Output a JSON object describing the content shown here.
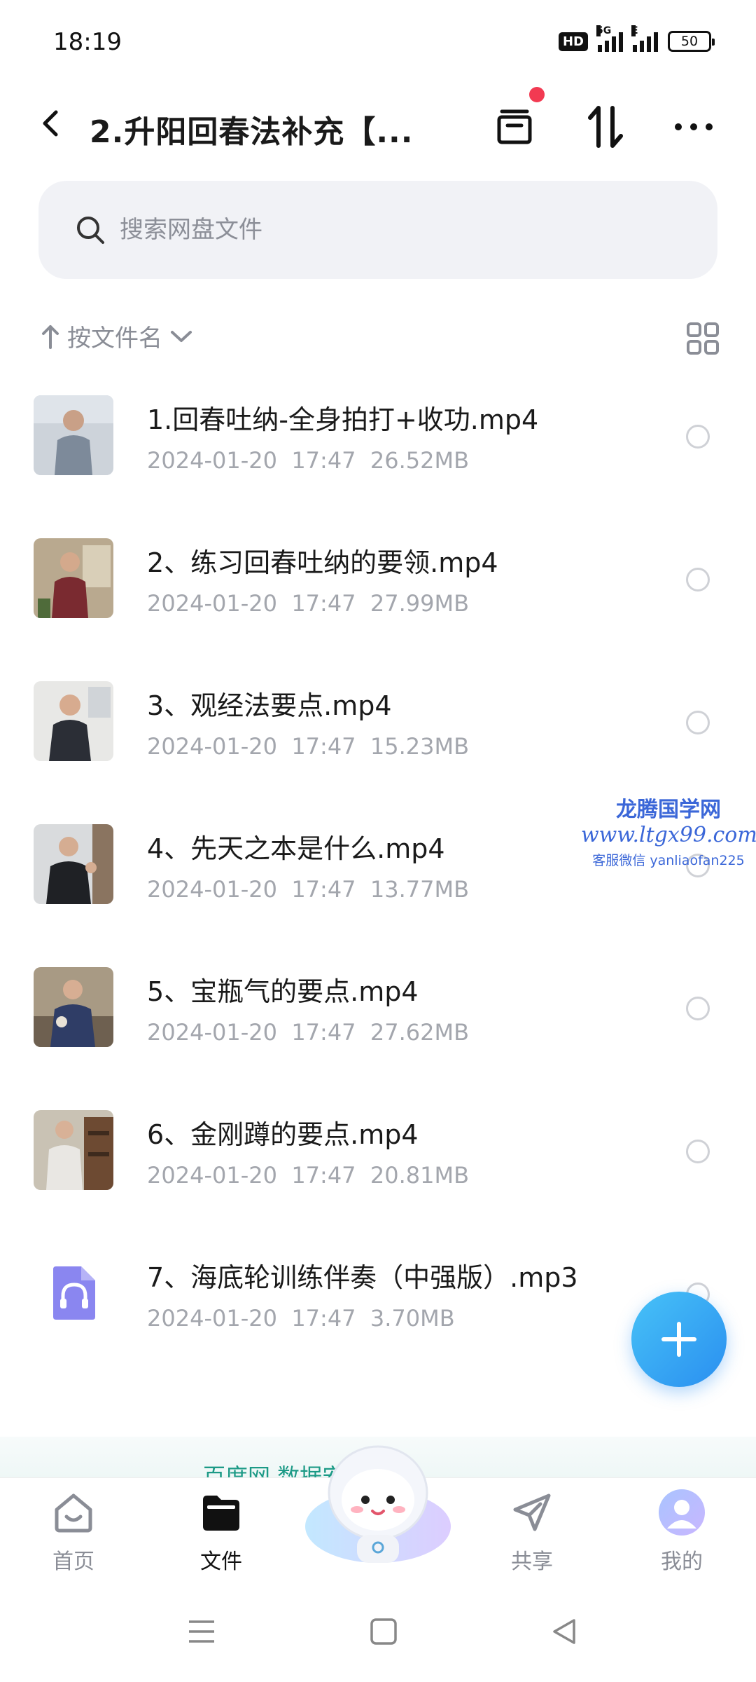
{
  "status": {
    "time": "18:19",
    "hd": "HD",
    "net": "5G",
    "net2": "E",
    "battery": "50"
  },
  "header": {
    "title": "2.升阳回春法补充【..."
  },
  "search": {
    "placeholder": "搜索网盘文件"
  },
  "sort": {
    "label": "按文件名"
  },
  "files": [
    {
      "name": "1.回春吐纳-全身拍打+收功.mp4",
      "date": "2024-01-20",
      "time": "17:47",
      "size": "26.52MB",
      "thumb": "video-thumbnail"
    },
    {
      "name": "2、练习回春吐纳的要领.mp4",
      "date": "2024-01-20",
      "time": "17:47",
      "size": "27.99MB",
      "thumb": "video-thumbnail"
    },
    {
      "name": "3、观经法要点.mp4",
      "date": "2024-01-20",
      "time": "17:47",
      "size": "15.23MB",
      "thumb": "video-thumbnail"
    },
    {
      "name": "4、先天之本是什么.mp4",
      "date": "2024-01-20",
      "time": "17:47",
      "size": "13.77MB",
      "thumb": "video-thumbnail"
    },
    {
      "name": "5、宝瓶气的要点.mp4",
      "date": "2024-01-20",
      "time": "17:47",
      "size": "27.62MB",
      "thumb": "video-thumbnail"
    },
    {
      "name": "6、金刚蹲的要点.mp4",
      "date": "2024-01-20",
      "time": "17:47",
      "size": "20.81MB",
      "thumb": "video-thumbnail"
    },
    {
      "name": "7、海底轮训练伴奏（中强版）.mp3",
      "date": "2024-01-20",
      "time": "17:47",
      "size": "3.70MB",
      "thumb": "audio-file-icon"
    }
  ],
  "watermark": {
    "line1": "龙腾国学网",
    "line2": "www.ltgx99.com",
    "line3": "客服微信 yanliaofan225"
  },
  "promo": {
    "text": "百度网 数据安全 〉"
  },
  "tabs": [
    {
      "label": "首页",
      "icon": "home-icon"
    },
    {
      "label": "文件",
      "icon": "folder-icon"
    },
    {
      "label": "共享",
      "icon": "send-icon"
    },
    {
      "label": "我的",
      "icon": "profile-icon"
    }
  ],
  "colors": {
    "accent": "#2a8ff0",
    "badge": "#f23a52",
    "muted": "#a3a6ad",
    "promo": "#1c9a86"
  }
}
